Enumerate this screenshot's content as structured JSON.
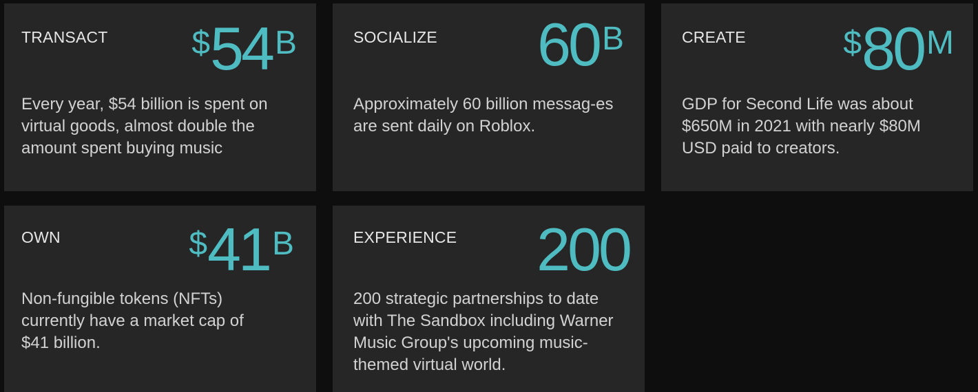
{
  "cards": [
    {
      "label": "TRANSACT",
      "stat": {
        "prefix": "$",
        "value": "54",
        "suffix": "B"
      },
      "description": "Every year, $54 billion is spent on virtual goods, almost double the amount spent buying music"
    },
    {
      "label": "SOCIALIZE",
      "stat": {
        "prefix": "",
        "value": "60",
        "suffix": "B"
      },
      "description": "Approximately 60 billion messag-es are sent daily on Roblox."
    },
    {
      "label": "CREATE",
      "stat": {
        "prefix": "$",
        "value": "80",
        "suffix": "M"
      },
      "description": "GDP for Second Life was about $650M in 2021 with nearly $80M USD paid to creators."
    },
    {
      "label": "OWN",
      "stat": {
        "prefix": "$",
        "value": "41",
        "suffix": "B"
      },
      "description": "Non-fungible tokens (NFTs) currently have a market cap of $41 billion."
    },
    {
      "label": "EXPERIENCE",
      "stat": {
        "prefix": "",
        "value": "200",
        "suffix": ""
      },
      "description": "200 strategic partnerships to date with The Sandbox including Warner Music Group's upcoming music-themed virtual world."
    }
  ],
  "colors": {
    "page_background": "#0e0e0e",
    "card_background": "#262626",
    "accent": "#4fbcc2",
    "label_text": "#e6e6e6",
    "body_text": "#d2d2d2"
  }
}
